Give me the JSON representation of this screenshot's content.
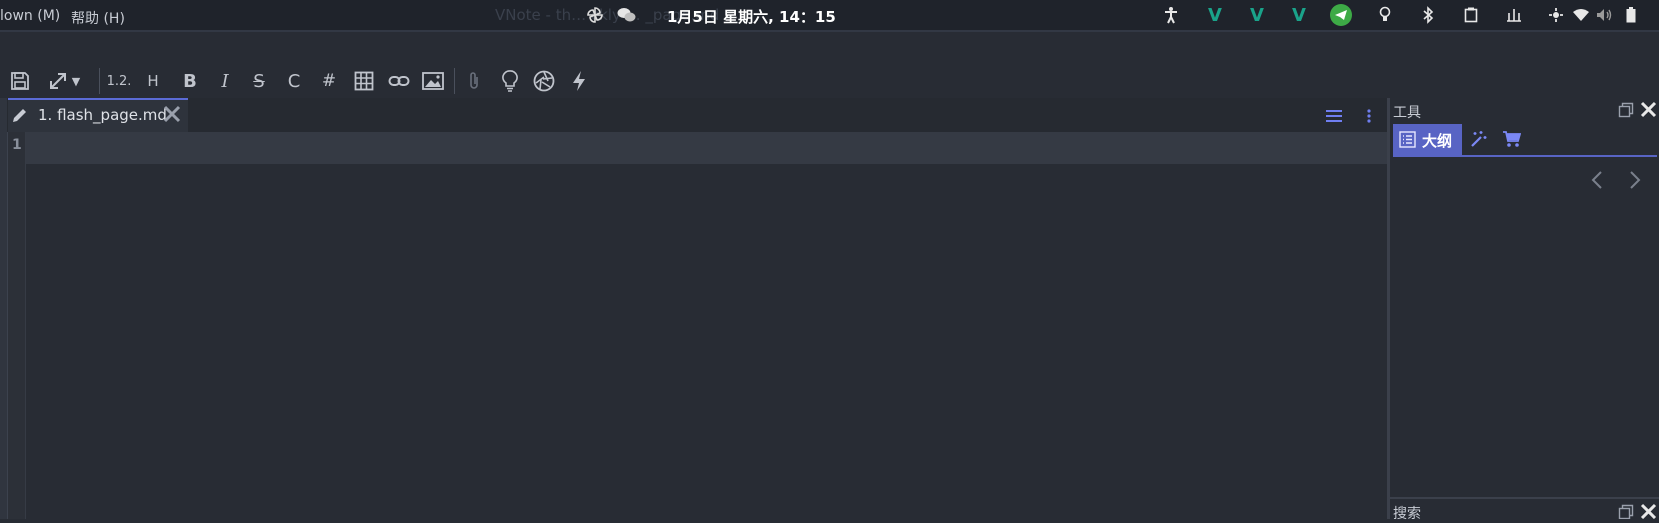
{
  "window": {
    "title": "VNote - th… ckly … _page.md"
  },
  "system_bar": {
    "clock": "1月5日 星期六, 14：15",
    "tray_icons": [
      "pinwheel-icon",
      "wechat-icon",
      "accessibility-icon",
      "vnote-icon",
      "vnote-icon",
      "vnote-icon",
      "telegram-icon",
      "bulb-icon",
      "bluetooth-icon",
      "clipboard-icon",
      "input-method-icon",
      "network-icon",
      "wifi-icon",
      "volume-icon",
      "battery-icon"
    ]
  },
  "menu": {
    "items": [
      "lown (M)",
      "帮助 (H)"
    ]
  },
  "toolbar": {
    "ordered_list": "1.2.",
    "heading": "H",
    "bold": "B",
    "italic": "I",
    "strikethrough": "S",
    "code": "C",
    "hash": "#"
  },
  "editor": {
    "tab_label": "1. flash_page.md",
    "line_number": "1"
  },
  "dock": {
    "title": "工具",
    "active_tab": "大纲",
    "lower_title": "搜索"
  },
  "colors": {
    "accent": "#5864c4",
    "background": "#282c34",
    "topbar": "#1f232b"
  }
}
